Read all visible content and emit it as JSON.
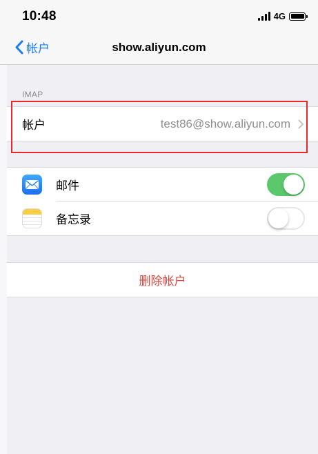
{
  "status_bar": {
    "time": "10:48",
    "network": "4G"
  },
  "nav": {
    "back_label": "帐户",
    "title": "show.aliyun.com"
  },
  "imap_section": {
    "header": "IMAP",
    "account_label": "帐户",
    "account_value": "test86@show.aliyun.com"
  },
  "apps": [
    {
      "label": "邮件",
      "icon": "mail-icon",
      "enabled": true
    },
    {
      "label": "备忘录",
      "icon": "notes-icon",
      "enabled": false
    }
  ],
  "delete_label": "删除帐户",
  "colors": {
    "accent": "#1a7cf5",
    "toggle_on": "#5bc96b",
    "destructive": "#e0473d",
    "highlight": "#e8282d"
  }
}
